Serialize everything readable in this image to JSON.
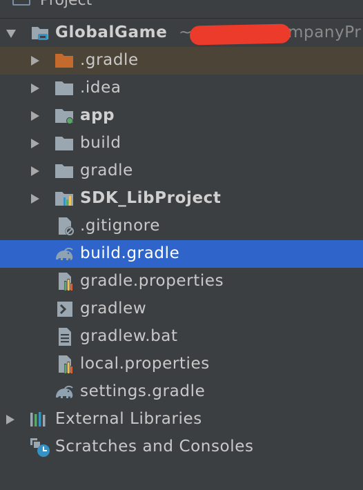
{
  "header": {
    "title": "Project"
  },
  "tree": {
    "root": {
      "label": "GlobalGame",
      "path_visible": "~",
      "path_tail_visible": "mpanyPr"
    },
    "items": [
      {
        "label": ".gradle"
      },
      {
        "label": ".idea"
      },
      {
        "label": "app"
      },
      {
        "label": "build"
      },
      {
        "label": "gradle"
      },
      {
        "label": "SDK_LibProject"
      },
      {
        "label": ".gitignore"
      },
      {
        "label": "build.gradle"
      },
      {
        "label": "gradle.properties"
      },
      {
        "label": "gradlew"
      },
      {
        "label": "gradlew.bat"
      },
      {
        "label": "local.properties"
      },
      {
        "label": "settings.gradle"
      }
    ],
    "external": {
      "label": "External Libraries"
    },
    "scratches": {
      "label": "Scratches and Consoles"
    }
  },
  "colors": {
    "background": "#3c3f41",
    "selection": "#2f65ca",
    "highlight_row": "#4b4437",
    "excluded_folder": "#c46a2c",
    "folder": "#9aa7b0"
  }
}
